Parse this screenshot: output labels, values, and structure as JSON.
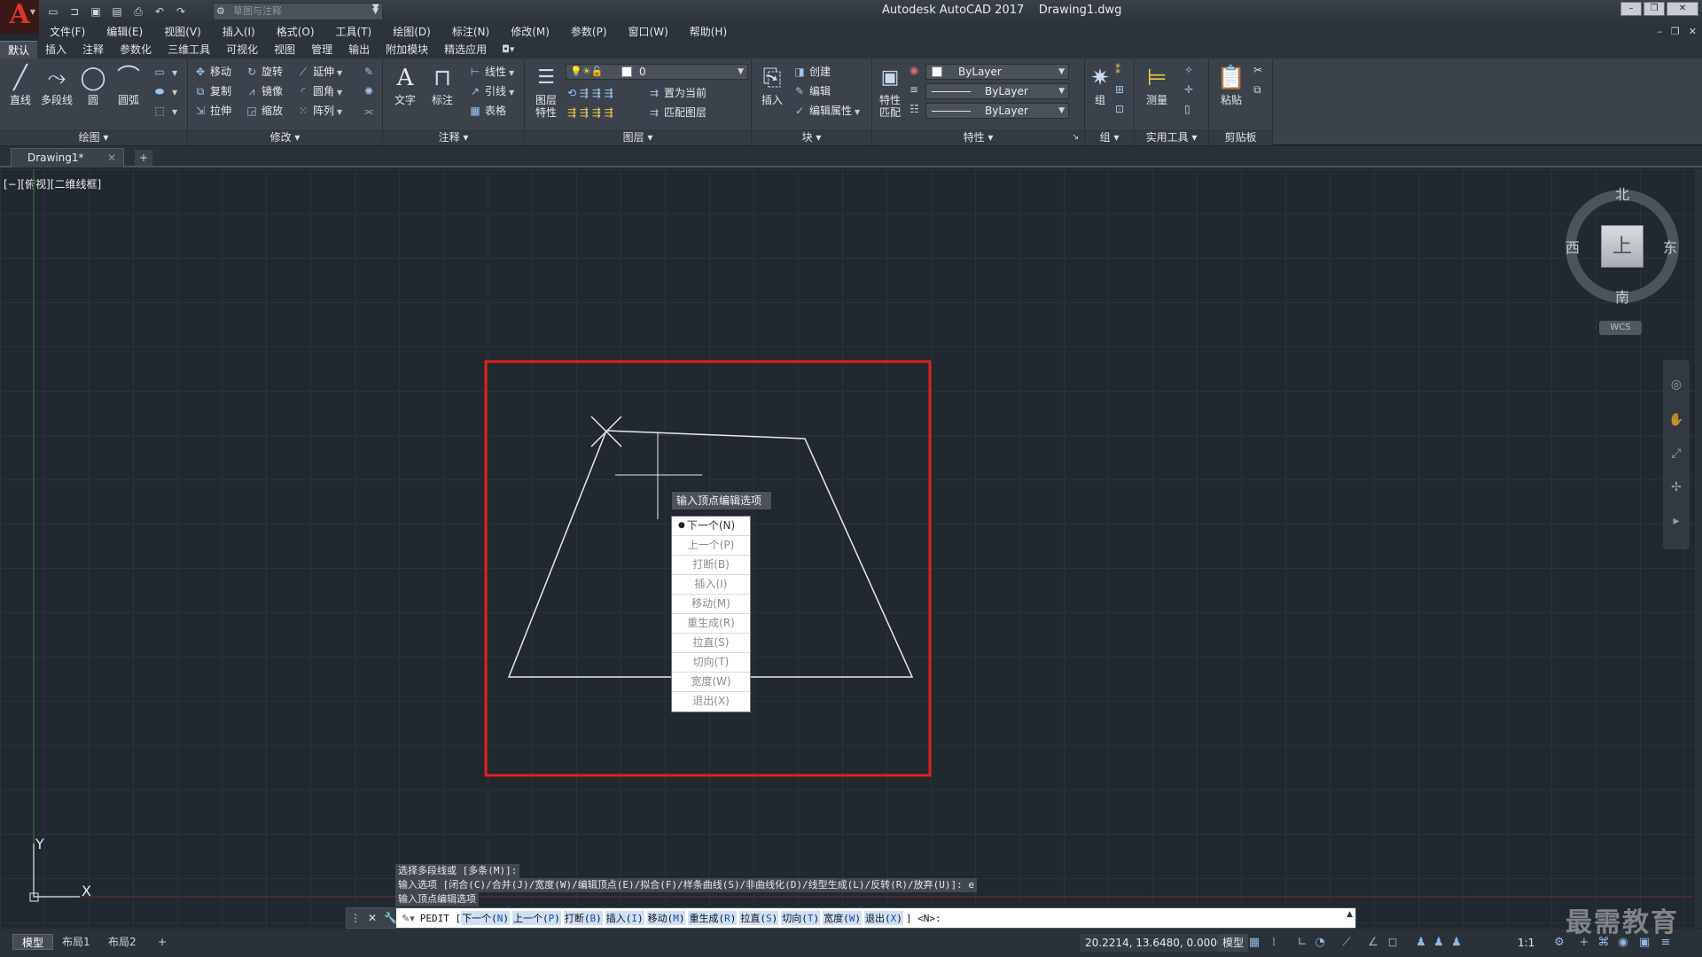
{
  "app": {
    "logo_letter": "A",
    "workspace_placeholder": "草图与注释",
    "title": "Autodesk AutoCAD 2017    Drawing1.dwg"
  },
  "menu": [
    "文件(F)",
    "编辑(E)",
    "视图(V)",
    "插入(I)",
    "格式(O)",
    "工具(T)",
    "绘图(D)",
    "标注(N)",
    "修改(M)",
    "参数(P)",
    "窗口(W)",
    "帮助(H)"
  ],
  "ribbon_tabs": [
    "默认",
    "插入",
    "注释",
    "参数化",
    "三维工具",
    "可视化",
    "视图",
    "管理",
    "输出",
    "附加模块",
    "精选应用"
  ],
  "ribbon": {
    "draw": {
      "title": "绘图",
      "line": "直线",
      "polyline": "多段线",
      "circle": "圆",
      "arc": "圆弧"
    },
    "modify": {
      "title": "修改",
      "move": "移动",
      "rotate": "旋转",
      "trim": "延伸",
      "copy": "复制",
      "mirror": "镜像",
      "fillet": "圆角",
      "stretch": "拉伸",
      "scale": "缩放",
      "array": "阵列"
    },
    "annotation": {
      "title": "注释",
      "text": "文字",
      "dimension": "标注",
      "linear": "线性",
      "leader": "引线",
      "table": "表格"
    },
    "layers": {
      "title": "图层",
      "layer_props": "图层特性",
      "layer_props_l1": "图层",
      "layer_props_l2": "特性",
      "current_layer": "0",
      "make_current": "置为当前",
      "match_layer": "匹配图层"
    },
    "block": {
      "title": "块",
      "insert": "插入",
      "create": "创建",
      "edit": "编辑",
      "edit_attr": "编辑属性"
    },
    "properties": {
      "title": "特性",
      "match_l1": "特性",
      "match_l2": "匹配",
      "color": "ByLayer",
      "linetype": "ByLayer",
      "lineweight": "ByLayer"
    },
    "groups": {
      "title": "组",
      "group": "组"
    },
    "utilities": {
      "title": "实用工具",
      "measure": "测量"
    },
    "clipboard": {
      "title": "剪贴板",
      "paste": "粘贴"
    }
  },
  "file_tab": {
    "name": "Drawing1*",
    "new_tab": "+"
  },
  "viewport": {
    "label": "[−][俯视][二维线框]"
  },
  "viewcube": {
    "north": "北",
    "south": "南",
    "east": "东",
    "west": "西",
    "top": "上",
    "wcs": "WCS"
  },
  "popup": {
    "prompt": "输入顶点编辑选项",
    "items": [
      "下一个(N)",
      "上一个(P)",
      "打断(B)",
      "插入(I)",
      "移动(M)",
      "重生成(R)",
      "拉直(S)",
      "切向(T)",
      "宽度(W)",
      "退出(X)"
    ],
    "selected": "下一个(N)"
  },
  "ucs": {
    "x": "X",
    "y": "Y"
  },
  "command_history": [
    "选择多段线或 [多条(M)]:",
    "输入选项 [闭合(C)/合并(J)/宽度(W)/编辑顶点(E)/拟合(F)/样条曲线(S)/非曲线化(D)/线型生成(L)/反转(R)/放弃(U)]: e",
    "输入顶点编辑选项"
  ],
  "command_line": {
    "command": "PEDIT [",
    "options": [
      {
        "label": "下一个(",
        "key": "N",
        "end": ")"
      },
      {
        "label": "上一个(",
        "key": "P",
        "end": ")"
      },
      {
        "label": "打断(",
        "key": "B",
        "end": ")"
      },
      {
        "label": "插入(",
        "key": "I",
        "end": ")"
      },
      {
        "label": "移动(",
        "key": "M",
        "end": ")"
      },
      {
        "label": "重生成(",
        "key": "R",
        "end": ")"
      },
      {
        "label": "拉直(",
        "key": "S",
        "end": ")"
      },
      {
        "label": "切向(",
        "key": "T",
        "end": ")"
      },
      {
        "label": "宽度(",
        "key": "W",
        "end": ")"
      },
      {
        "label": "退出(",
        "key": "X",
        "end": ")"
      }
    ],
    "suffix": "] <N>:"
  },
  "layout_tabs": [
    "模型",
    "布局1",
    "布局2",
    "+"
  ],
  "status": {
    "coords": "20.2214, 13.6480, 0.0000",
    "model": "模型",
    "scale": "1:1"
  },
  "watermark": "最需教育",
  "colors": {
    "background": "#212830",
    "highlight_box": "#e0211c",
    "geometry": "#e8e8e8"
  }
}
